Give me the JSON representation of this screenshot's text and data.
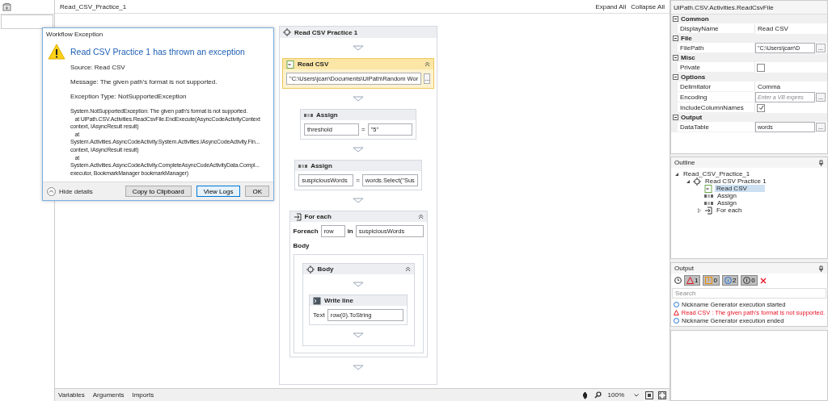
{
  "designer": {
    "title": "Read_CSV_Practice_1",
    "expand_all": "Expand All",
    "collapse_all": "Collapse All"
  },
  "dialog": {
    "title": "Workflow Exception",
    "heading": "Read CSV Practice 1 has thrown an exception",
    "lines": [
      "Source: Read CSV",
      "Message: The given path's format is not supported.",
      "Exception Type: NotSupportedException"
    ],
    "stack": "System.NotSupportedException: The given path's format is not supported.\n   at UiPath.CSV.Activities.ReadCsvFile.EndExecute(AsyncCodeActivityContext\ncontext, IAsyncResult result)\n   at\nSystem.Activities.AsyncCodeActivity.System.Activities.IAsyncCodeActivity.Fin...\ncontext, IAsyncResult result)\n   at\nSystem.Activities.AsyncCodeActivity.CompleteAsyncCodeActivityData.Compl...\nexecutor, BookmarkManager bookmarkManager)",
    "hide_details": "Hide details",
    "buttons": [
      {
        "label": "Copy to Clipboard",
        "selected": false
      },
      {
        "label": "View Logs",
        "selected": true
      },
      {
        "label": "OK",
        "selected": false
      }
    ]
  },
  "sequence": {
    "title": "Read CSV Practice 1",
    "activities": [
      {
        "kind": "read_csv",
        "title": "Read CSV",
        "selected": true,
        "path": "\"C:\\Users\\jcarr\\Documents\\UiPath\\Random Wor",
        "button": "..."
      },
      {
        "kind": "assign",
        "title": "Assign",
        "selected": false,
        "to": "threshold",
        "eq": "=",
        "value": "\"5\""
      },
      {
        "kind": "assign",
        "title": "Assign",
        "selected": false,
        "to": "suspiciousWords",
        "eq": "=",
        "value": "words.Select(\"Sus"
      },
      {
        "kind": "foreach",
        "title": "For each",
        "selected": false,
        "foreach_label": "Foreach",
        "item": "row",
        "in_label": "in",
        "collection": "suspiciousWords",
        "body_label": "Body",
        "body": {
          "title": "Body",
          "activity": {
            "title": "Write line",
            "text_label": "Text",
            "text": "row(0).ToString"
          }
        }
      }
    ]
  },
  "properties": {
    "title": "UiPath.CSV.Activities.ReadCsvFile",
    "categories": [
      {
        "name": "Common",
        "rows": [
          {
            "name": "DisplayName",
            "kind": "text",
            "value": "Read CSV"
          }
        ]
      },
      {
        "name": "File",
        "rows": [
          {
            "name": "FilePath",
            "kind": "field",
            "value": "\"C:\\Users\\jcarr\\D",
            "button": "..."
          }
        ]
      },
      {
        "name": "Misc",
        "rows": [
          {
            "name": "Private",
            "kind": "checkbox",
            "checked": false
          }
        ]
      },
      {
        "name": "Options",
        "rows": [
          {
            "name": "Delimitator",
            "kind": "text",
            "value": "Comma"
          },
          {
            "name": "Encoding",
            "kind": "field",
            "placeholder": "Enter a VB expres",
            "button": "..."
          },
          {
            "name": "IncludeColumnNames",
            "kind": "checkbox",
            "checked": true
          }
        ]
      },
      {
        "name": "Output",
        "rows": [
          {
            "name": "DataTable",
            "kind": "field",
            "value": "words",
            "button": "..."
          }
        ]
      }
    ]
  },
  "outline": {
    "title": "Outline",
    "tree": [
      {
        "label": "Read_CSV_Practice_1",
        "selected": false,
        "expanded": true,
        "children": [
          {
            "label": "Read CSV Practice 1",
            "kind": "sequence",
            "selected": false,
            "expanded": true,
            "children": [
              {
                "label": "Read CSV",
                "kind": "read_csv",
                "selected": true
              },
              {
                "label": "Assign",
                "kind": "assign",
                "selected": false
              },
              {
                "label": "Assign",
                "kind": "assign",
                "selected": false
              },
              {
                "label": "For each",
                "kind": "foreach",
                "selected": false,
                "expanded": false
              }
            ]
          }
        ]
      }
    ]
  },
  "output": {
    "title": "Output",
    "filters": [
      {
        "kind": "error",
        "count": "1",
        "selected": true
      },
      {
        "kind": "warning",
        "count": "0",
        "selected": true
      },
      {
        "kind": "info",
        "count": "2",
        "selected": true
      },
      {
        "kind": "trace",
        "count": "0",
        "selected": true
      }
    ],
    "search_placeholder": "Search",
    "messages": [
      {
        "kind": "info",
        "text": "Nickname Generator execution started"
      },
      {
        "kind": "error",
        "text": "Read CSV : The given path's format is not supported."
      },
      {
        "kind": "info",
        "text": "Nickname Generator execution ended"
      }
    ]
  },
  "bottom_bar": {
    "tabs": [
      "Variables",
      "Arguments",
      "Imports"
    ],
    "zoom": "100%"
  }
}
